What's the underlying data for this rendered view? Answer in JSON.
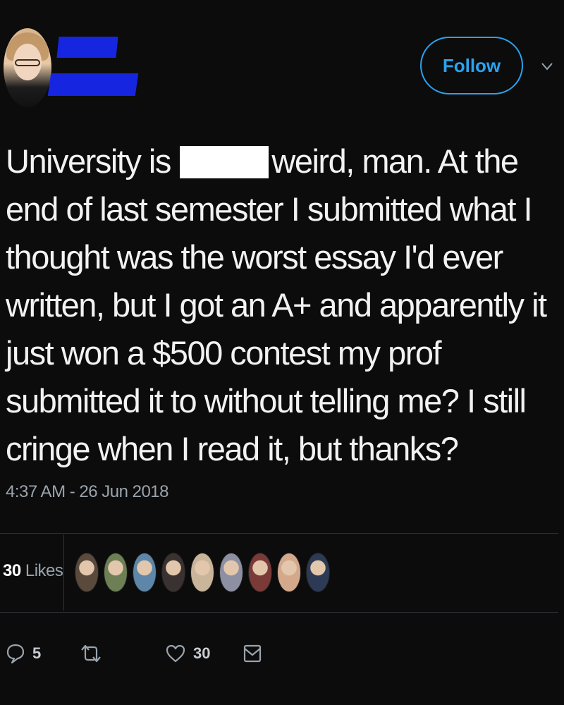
{
  "follow_label": "Follow",
  "tweet": {
    "text_before": "University is",
    "text_after": "weird, man. At the end of last semester I submitted what I thought was the worst essay I'd ever written, but I got an A+ and apparently it just won a $500 contest my prof submitted it to without telling me? I still cringe when I read it, but thanks?",
    "timestamp": "4:37 AM - 26 Jun 2018"
  },
  "likes": {
    "count": "30",
    "label": "Likes"
  },
  "liker_avatar_colors": [
    "#5a4a3c",
    "#6d7f55",
    "#5d86a8",
    "#3a3230",
    "#c9b59a",
    "#8d8fa3",
    "#7a3a38",
    "#d4a98b",
    "#2c3a55"
  ],
  "actions": {
    "replies": "5",
    "likes": "30"
  },
  "colors": {
    "accent": "#2aa3ef",
    "background": "#0c0c0c",
    "muted": "#9aa4ad",
    "redaction": "#1626e0"
  }
}
